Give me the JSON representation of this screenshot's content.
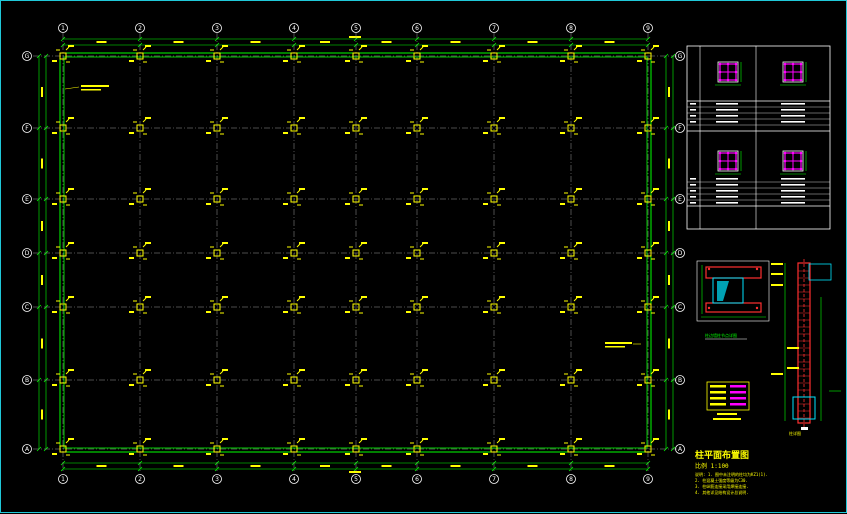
{
  "drawing": {
    "colors": {
      "background": "#000000",
      "frame": "#20c8d8",
      "grid_line": "#9a9a9a",
      "wall": "#00ff00",
      "column": "#ffff00",
      "bubble": "#ffffff",
      "rebar": "#ff00ff",
      "note_text": "#ffff00",
      "detail_red": "#ff3030",
      "detail_cyan": "#00e5ff"
    },
    "grid_x_labels": [
      "1",
      "2",
      "3",
      "4",
      "5",
      "6",
      "7",
      "8",
      "9"
    ],
    "grid_y_labels": [
      "G",
      "F",
      "E",
      "D",
      "C",
      "B",
      "A"
    ],
    "plan_title": "柱平面布置图",
    "plan_scale": "比例 1:100",
    "notes": [
      "说明: 1. 图中未注明的柱均为KZ1(1).",
      "2. 柱混凝土强度等级为C30.",
      "3. 柱纵筋连接采用焊接连接.",
      "4. 其他详见结构设计总说明."
    ],
    "detail_title_1": "柱边墙柱节点详图",
    "detail_title_2": "柱详图",
    "column_schedule": {
      "row_labels": [
        "编号",
        "标高",
        "纵筋",
        "箍筋"
      ],
      "columns": [
        "KZ1",
        "KZ2",
        "KZ3",
        "KZ4"
      ]
    }
  }
}
